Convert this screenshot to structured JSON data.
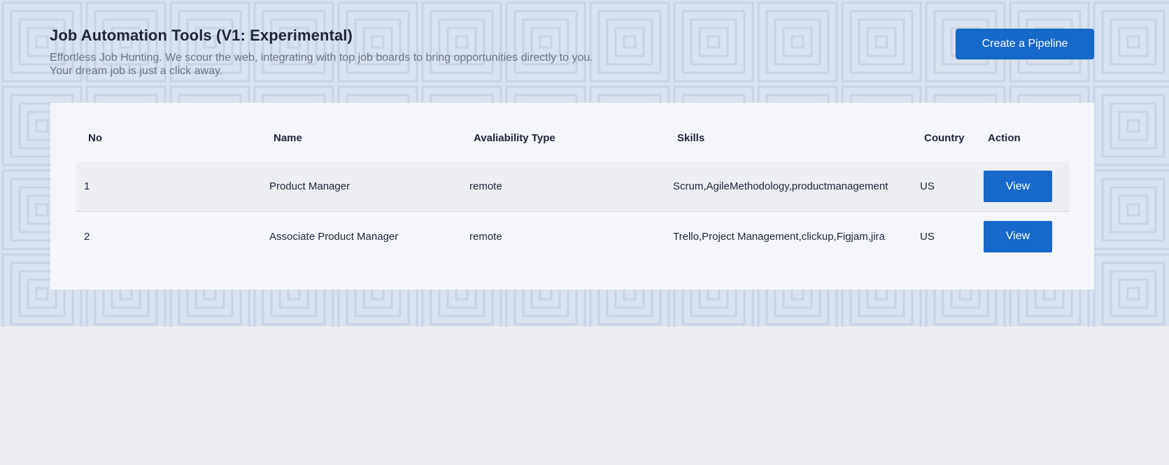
{
  "header": {
    "title": "Job Automation Tools (V1: Experimental)",
    "subtitle_line1": "Effortless Job Hunting. We scour the web, integrating with top job boards to bring opportunities directly to you.",
    "subtitle_line2": "Your dream job is just a click away.",
    "create_button_label": "Create a Pipeline"
  },
  "table": {
    "columns": [
      "No",
      "Name",
      "Avaliability Type",
      "Skills",
      "Country",
      "Action"
    ],
    "rows": [
      {
        "no": "1",
        "name": "Product Manager",
        "availability": "remote",
        "skills": "Scrum,AgileMethodology,productmanagement",
        "country": "US",
        "action": "View"
      },
      {
        "no": "2",
        "name": "Associate Product Manager",
        "availability": "remote",
        "skills": "Trello,Project Management,clickup,Figjam,jira",
        "country": "US",
        "action": "View"
      }
    ]
  },
  "colors": {
    "accent": "#1668c9",
    "hero_background": "#d9e2ef",
    "page_background": "#ecedf1",
    "card_background": "#f4f6fa"
  }
}
